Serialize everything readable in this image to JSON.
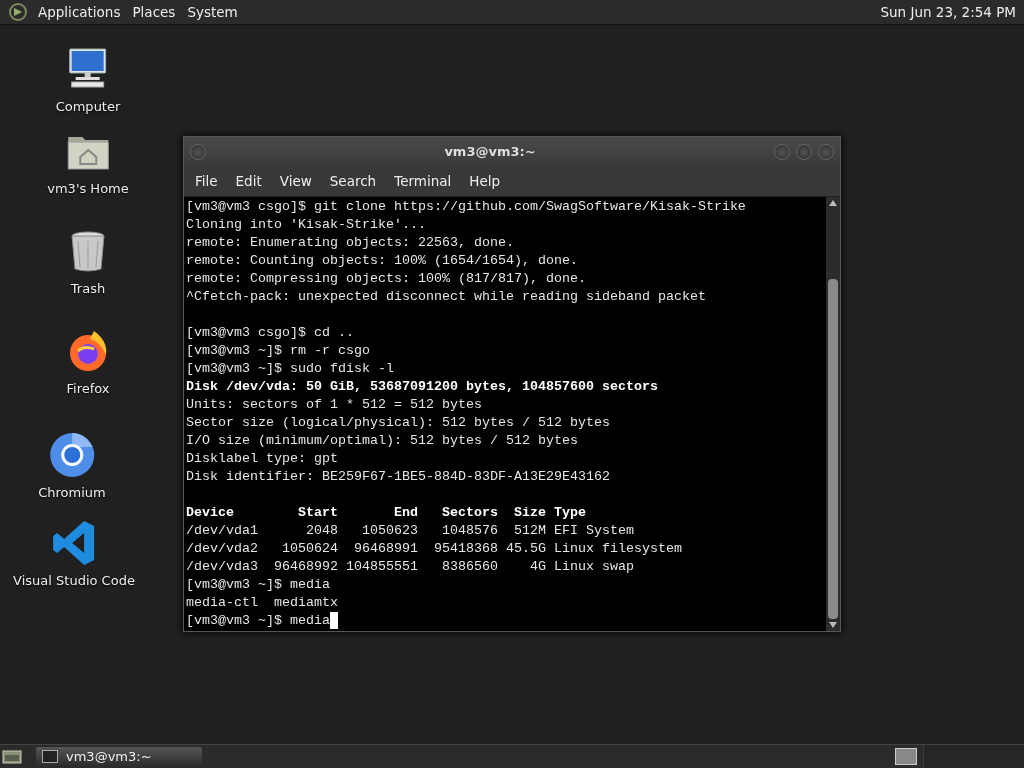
{
  "top_panel": {
    "menus": [
      "Applications",
      "Places",
      "System"
    ],
    "clock": "Sun Jun 23,  2:54 PM"
  },
  "desktop_icons": [
    {
      "kind": "computer",
      "label": "Computer"
    },
    {
      "kind": "home",
      "label": "vm3's Home"
    },
    {
      "kind": "trash",
      "label": "Trash"
    },
    {
      "kind": "firefox",
      "label": "Firefox"
    },
    {
      "kind": "chromium",
      "label": "Chromium"
    },
    {
      "kind": "vscode",
      "label": "Visual Studio Code"
    }
  ],
  "window": {
    "title": "vm3@vm3:~",
    "menu": [
      "File",
      "Edit",
      "View",
      "Search",
      "Terminal",
      "Help"
    ],
    "lines": [
      {
        "kind": "text",
        "text": "[vm3@vm3 csgo]$ git clone https://github.com/SwagSoftware/Kisak-Strike",
        "bold": false
      },
      {
        "kind": "text",
        "text": "Cloning into 'Kisak-Strike'...",
        "bold": false
      },
      {
        "kind": "text",
        "text": "remote: Enumerating objects: 22563, done.",
        "bold": false
      },
      {
        "kind": "text",
        "text": "remote: Counting objects: 100% (1654/1654), done.",
        "bold": false
      },
      {
        "kind": "text",
        "text": "remote: Compressing objects: 100% (817/817), done.",
        "bold": false
      },
      {
        "kind": "text",
        "text": "^Cfetch-pack: unexpected disconnect while reading sideband packet",
        "bold": false
      },
      {
        "kind": "blank"
      },
      {
        "kind": "text",
        "text": "[vm3@vm3 csgo]$ cd ..",
        "bold": false
      },
      {
        "kind": "text",
        "text": "[vm3@vm3 ~]$ rm -r csgo",
        "bold": false
      },
      {
        "kind": "text",
        "text": "[vm3@vm3 ~]$ sudo fdisk -l",
        "bold": false
      },
      {
        "kind": "text",
        "text": "Disk /dev/vda: 50 GiB, 53687091200 bytes, 104857600 sectors",
        "bold": true
      },
      {
        "kind": "text",
        "text": "Units: sectors of 1 * 512 = 512 bytes",
        "bold": false
      },
      {
        "kind": "text",
        "text": "Sector size (logical/physical): 512 bytes / 512 bytes",
        "bold": false
      },
      {
        "kind": "text",
        "text": "I/O size (minimum/optimal): 512 bytes / 512 bytes",
        "bold": false
      },
      {
        "kind": "text",
        "text": "Disklabel type: gpt",
        "bold": false
      },
      {
        "kind": "text",
        "text": "Disk identifier: BE259F67-1BE5-884D-83DF-A13E29E43162",
        "bold": false
      },
      {
        "kind": "blank"
      },
      {
        "kind": "text",
        "text": "Device        Start       End   Sectors  Size Type",
        "bold": true
      },
      {
        "kind": "text",
        "text": "/dev/vda1      2048   1050623   1048576  512M EFI System",
        "bold": false
      },
      {
        "kind": "text",
        "text": "/dev/vda2   1050624  96468991  95418368 45.5G Linux filesystem",
        "bold": false
      },
      {
        "kind": "text",
        "text": "/dev/vda3  96468992 104855551   8386560    4G Linux swap",
        "bold": false
      },
      {
        "kind": "text",
        "text": "[vm3@vm3 ~]$ media",
        "bold": false
      },
      {
        "kind": "text",
        "text": "media-ctl  mediamtx",
        "bold": false
      },
      {
        "kind": "text",
        "text": "[vm3@vm3 ~]$ media",
        "bold": false,
        "cursor": true
      }
    ]
  },
  "taskbar": {
    "tasks": [
      {
        "label": "vm3@vm3:~",
        "selected": true
      }
    ]
  }
}
